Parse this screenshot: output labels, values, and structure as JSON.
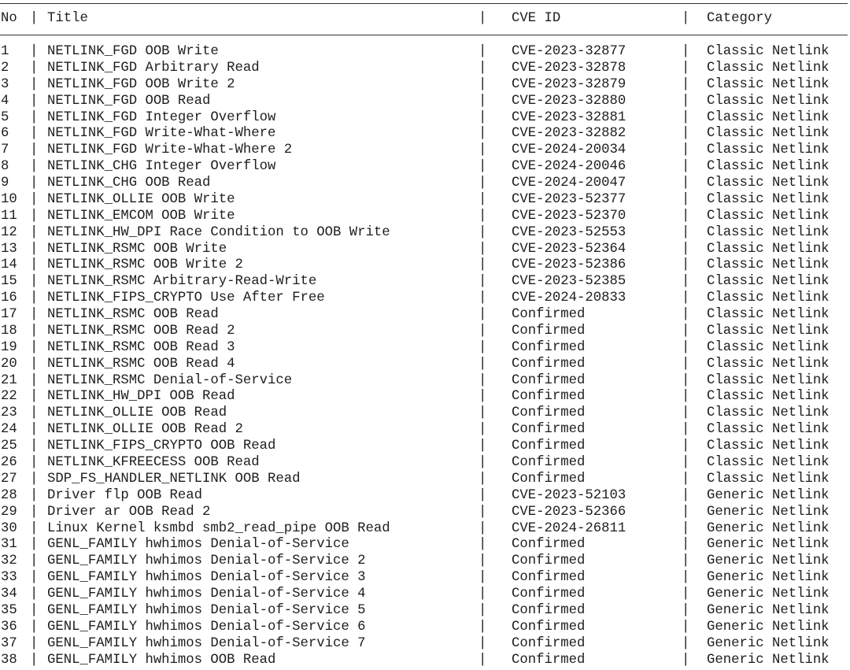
{
  "header": {
    "no": "No",
    "title": "Title",
    "cve_id": "CVE ID",
    "category": "Category",
    "separator": "|"
  },
  "rows": [
    {
      "no": "1",
      "title": "NETLINK_FGD OOB Write",
      "cve": "CVE-2023-32877",
      "category": "Classic Netlink"
    },
    {
      "no": "2",
      "title": "NETLINK_FGD Arbitrary Read",
      "cve": "CVE-2023-32878",
      "category": "Classic Netlink"
    },
    {
      "no": "3",
      "title": "NETLINK_FGD OOB Write 2",
      "cve": "CVE-2023-32879",
      "category": "Classic Netlink"
    },
    {
      "no": "4",
      "title": "NETLINK_FGD OOB Read",
      "cve": "CVE-2023-32880",
      "category": "Classic Netlink"
    },
    {
      "no": "5",
      "title": "NETLINK_FGD Integer Overflow",
      "cve": "CVE-2023-32881",
      "category": "Classic Netlink"
    },
    {
      "no": "6",
      "title": "NETLINK_FGD Write-What-Where",
      "cve": "CVE-2023-32882",
      "category": "Classic Netlink"
    },
    {
      "no": "7",
      "title": "NETLINK_FGD Write-What-Where 2",
      "cve": "CVE-2024-20034",
      "category": "Classic Netlink"
    },
    {
      "no": "8",
      "title": "NETLINK_CHG Integer Overflow",
      "cve": "CVE-2024-20046",
      "category": "Classic Netlink"
    },
    {
      "no": "9",
      "title": "NETLINK_CHG OOB Read",
      "cve": "CVE-2024-20047",
      "category": "Classic Netlink"
    },
    {
      "no": "10",
      "title": "NETLINK_OLLIE OOB Write",
      "cve": "CVE-2023-52377",
      "category": "Classic Netlink"
    },
    {
      "no": "11",
      "title": "NETLINK_EMCOM OOB Write",
      "cve": "CVE-2023-52370",
      "category": "Classic Netlink"
    },
    {
      "no": "12",
      "title": "NETLINK_HW_DPI Race Condition to OOB Write",
      "cve": "CVE-2023-52553",
      "category": "Classic Netlink"
    },
    {
      "no": "13",
      "title": "NETLINK_RSMC OOB Write",
      "cve": "CVE-2023-52364",
      "category": "Classic Netlink"
    },
    {
      "no": "14",
      "title": "NETLINK_RSMC OOB Write 2",
      "cve": "CVE-2023-52386",
      "category": "Classic Netlink"
    },
    {
      "no": "15",
      "title": "NETLINK_RSMC Arbitrary-Read-Write",
      "cve": "CVE-2023-52385",
      "category": "Classic Netlink"
    },
    {
      "no": "16",
      "title": "NETLINK_FIPS_CRYPTO Use After Free",
      "cve": "CVE-2024-20833",
      "category": "Classic Netlink"
    },
    {
      "no": "17",
      "title": "NETLINK_RSMC OOB Read",
      "cve": "Confirmed",
      "category": "Classic Netlink"
    },
    {
      "no": "18",
      "title": "NETLINK_RSMC OOB Read 2",
      "cve": "Confirmed",
      "category": "Classic Netlink"
    },
    {
      "no": "19",
      "title": "NETLINK_RSMC OOB Read 3",
      "cve": "Confirmed",
      "category": "Classic Netlink"
    },
    {
      "no": "20",
      "title": "NETLINK_RSMC OOB Read 4",
      "cve": "Confirmed",
      "category": "Classic Netlink"
    },
    {
      "no": "21",
      "title": "NETLINK_RSMC Denial-of-Service",
      "cve": "Confirmed",
      "category": "Classic Netlink"
    },
    {
      "no": "22",
      "title": "NETLINK_HW_DPI OOB Read",
      "cve": "Confirmed",
      "category": "Classic Netlink"
    },
    {
      "no": "23",
      "title": "NETLINK_OLLIE OOB Read",
      "cve": "Confirmed",
      "category": "Classic Netlink"
    },
    {
      "no": "24",
      "title": "NETLINK_OLLIE OOB Read 2",
      "cve": "Confirmed",
      "category": "Classic Netlink"
    },
    {
      "no": "25",
      "title": "NETLINK_FIPS_CRYPTO OOB Read",
      "cve": "Confirmed",
      "category": "Classic Netlink"
    },
    {
      "no": "26",
      "title": "NETLINK_KFREECESS OOB Read",
      "cve": "Confirmed",
      "category": "Classic Netlink"
    },
    {
      "no": "27",
      "title": "SDP_FS_HANDLER_NETLINK OOB Read",
      "cve": "Confirmed",
      "category": "Classic Netlink"
    },
    {
      "no": "28",
      "title": "Driver flp OOB Read",
      "cve": "CVE-2023-52103",
      "category": "Generic Netlink"
    },
    {
      "no": "29",
      "title": "Driver ar OOB Read 2",
      "cve": "CVE-2023-52366",
      "category": "Generic Netlink"
    },
    {
      "no": "30",
      "title": "Linux Kernel ksmbd smb2_read_pipe OOB Read",
      "cve": "CVE-2024-26811",
      "category": "Generic Netlink"
    },
    {
      "no": "31",
      "title": "GENL_FAMILY hwhimos Denial-of-Service",
      "cve": "Confirmed",
      "category": "Generic Netlink"
    },
    {
      "no": "32",
      "title": "GENL_FAMILY hwhimos Denial-of-Service 2",
      "cve": "Confirmed",
      "category": "Generic Netlink"
    },
    {
      "no": "33",
      "title": "GENL_FAMILY hwhimos Denial-of-Service 3",
      "cve": "Confirmed",
      "category": "Generic Netlink"
    },
    {
      "no": "34",
      "title": "GENL_FAMILY hwhimos Denial-of-Service 4",
      "cve": "Confirmed",
      "category": "Generic Netlink"
    },
    {
      "no": "35",
      "title": "GENL_FAMILY hwhimos Denial-of-Service 5",
      "cve": "Confirmed",
      "category": "Generic Netlink"
    },
    {
      "no": "36",
      "title": "GENL_FAMILY hwhimos Denial-of-Service 6",
      "cve": "Confirmed",
      "category": "Generic Netlink"
    },
    {
      "no": "37",
      "title": "GENL_FAMILY hwhimos Denial-of-Service 7",
      "cve": "Confirmed",
      "category": "Generic Netlink"
    },
    {
      "no": "38",
      "title": "GENL_FAMILY hwhimos OOB Read",
      "cve": "Confirmed",
      "category": "Generic Netlink"
    }
  ]
}
